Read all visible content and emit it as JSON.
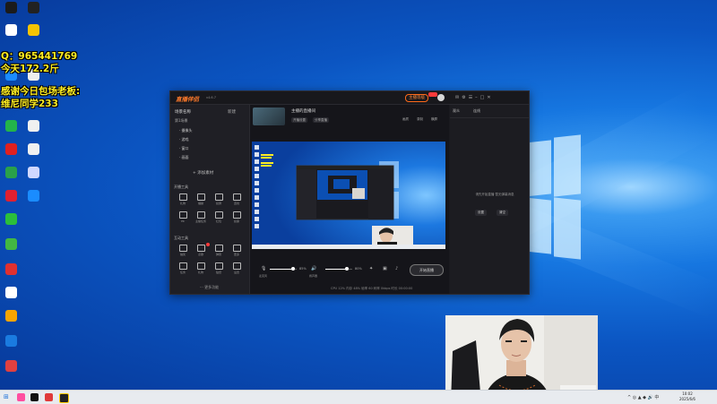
{
  "overlay": {
    "qq": "Q：965441769",
    "today": "今天172.2斤",
    "thanks": "感谢今日包场老板:",
    "boss": "维尼同学233"
  },
  "desktop_icons": [
    {
      "label": "",
      "color": "#1b1b1b"
    },
    {
      "label": "",
      "color": "#222"
    },
    {
      "label": "",
      "color": "#ffffff"
    },
    {
      "label": "",
      "color": "#f5c400"
    },
    {
      "label": "",
      "color": "#1a8cff"
    },
    {
      "label": "",
      "color": "#eeeeee"
    },
    {
      "label": "",
      "color": "#23b34a"
    },
    {
      "label": "",
      "color": "#f0f0f0"
    },
    {
      "label": "",
      "color": "#e02020"
    },
    {
      "label": "",
      "color": "#f0f0f0"
    },
    {
      "label": "",
      "color": "#2aa14a"
    },
    {
      "label": "",
      "color": "#d0d8ff"
    },
    {
      "label": "",
      "color": "#e02030"
    },
    {
      "label": "",
      "color": "#1a8cff"
    },
    {
      "label": "",
      "color": "#2bbf3b"
    },
    {
      "label": "",
      "color": "#42b842"
    },
    {
      "label": "",
      "color": "#e03030"
    },
    {
      "label": "",
      "color": "#ffffff"
    },
    {
      "label": "",
      "color": "#f7a500"
    },
    {
      "label": "",
      "color": "#1a7be0"
    },
    {
      "label": "",
      "color": "#e04040"
    }
  ],
  "app": {
    "logo_main": "直播伴侣",
    "logo_sub": "",
    "version": "v4.6.7",
    "upgrade": "主播等级",
    "sidebar": {
      "header": "场景名称",
      "header_right": "新建",
      "subheader": "第1场景",
      "scenes": [
        "· 摄像头",
        "· 游戏",
        "· 窗口",
        "· 画面"
      ],
      "add_source": "+ 添加素材",
      "section_live": "开播工具",
      "section_interact": "互动工具",
      "live_tools": [
        "礼物",
        "福袋",
        "投屏",
        "连线",
        "PK",
        "主播任务",
        "红包",
        "投票"
      ],
      "interact_tools": [
        "抽奖",
        "点歌",
        "弹幕",
        "更多",
        "任务",
        "礼物",
        "贴纸",
        "设置"
      ],
      "more": "··· 更多功能"
    },
    "main": {
      "room_title": "主播的直播间",
      "chips": [
        "开播设置",
        "分享直播"
      ],
      "tools": [
        "画质",
        "录制",
        "横屏"
      ],
      "mic_pct": "85%",
      "spk_pct": "80%",
      "mic_label": "麦克风",
      "spk_label": "扬声器",
      "start_button": "开始直播",
      "status": "CPU 12%  内存 48%  帧率 60  码率 0kbps  时长 00:00:00"
    },
    "chat": {
      "tabs": [
        "观众",
        "连线"
      ],
      "message": "请先开始直播 暂无弹幕消息",
      "buttons": [
        "设置",
        "清空"
      ]
    }
  },
  "taskbar": {
    "clock_time": "10:02",
    "clock_date": "2025/6/6"
  }
}
